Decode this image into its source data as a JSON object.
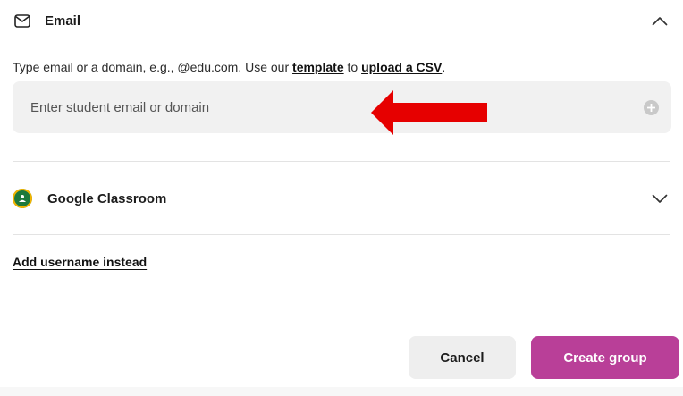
{
  "email_section": {
    "title": "Email",
    "icon": "mail-icon",
    "expanded": true,
    "help": {
      "prefix": "Type email or a domain, e.g., @edu.com. Use our ",
      "template_link": "template",
      "middle": " to ",
      "upload_link": "upload a CSV",
      "suffix": "."
    },
    "input": {
      "value": "",
      "placeholder": "Enter student email or domain"
    }
  },
  "google_classroom_section": {
    "title": "Google Classroom",
    "icon": "google-classroom-icon",
    "expanded": false
  },
  "alt_link": "Add username instead",
  "actions": {
    "cancel_label": "Cancel",
    "create_label": "Create group"
  },
  "colors": {
    "primary": "#b93f98",
    "annotation_arrow": "#e60000",
    "input_bg": "#f1f1f1"
  }
}
